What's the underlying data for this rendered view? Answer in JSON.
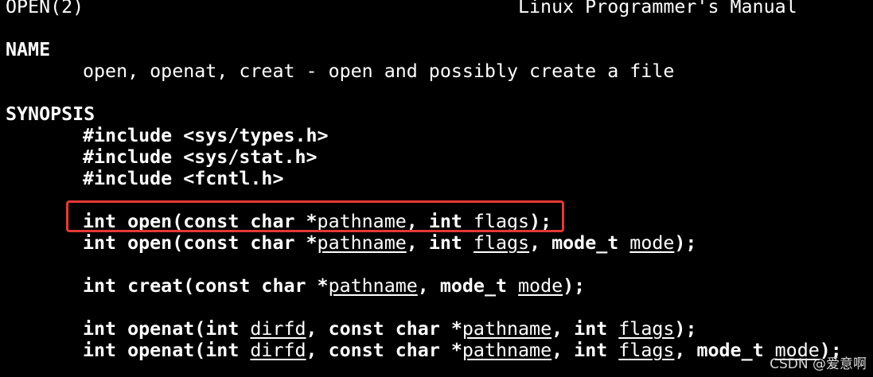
{
  "header": {
    "left": "OPEN(2)",
    "right": "Linux Programmer's Manual"
  },
  "sections": {
    "name": {
      "title": "NAME",
      "text": "open, openat, creat - open and possibly create a file"
    },
    "synopsis": {
      "title": "SYNOPSIS",
      "includes": [
        "#include <sys/types.h>",
        "#include <sys/stat.h>",
        "#include <fcntl.h>"
      ],
      "signatures": [
        {
          "head": "int open(const char *",
          "args": [
            {
              "sep": "",
              "name": "pathname"
            },
            {
              "sep": ", int ",
              "name": "flags"
            }
          ],
          "tail": ");"
        },
        {
          "head": "int open(const char *",
          "args": [
            {
              "sep": "",
              "name": "pathname"
            },
            {
              "sep": ", int ",
              "name": "flags"
            },
            {
              "sep": ", mode_t ",
              "name": "mode"
            }
          ],
          "tail": ");"
        },
        {
          "head": "int creat(const char *",
          "args": [
            {
              "sep": "",
              "name": "pathname"
            },
            {
              "sep": ", mode_t ",
              "name": "mode"
            }
          ],
          "tail": ");"
        },
        {
          "head": "int openat(int ",
          "args": [
            {
              "sep": "",
              "name": "dirfd"
            },
            {
              "sep": ", const char *",
              "name": "pathname"
            },
            {
              "sep": ", int ",
              "name": "flags"
            }
          ],
          "tail": ");"
        },
        {
          "head": "int openat(int ",
          "args": [
            {
              "sep": "",
              "name": "dirfd"
            },
            {
              "sep": ", const char *",
              "name": "pathname"
            },
            {
              "sep": ", int ",
              "name": "flags"
            },
            {
              "sep": ", mode_t ",
              "name": "mode"
            }
          ],
          "tail": ");"
        }
      ]
    }
  },
  "highlight": {
    "color": "#e53935"
  },
  "watermark": "CSDN @爱意啊",
  "colors": {
    "background": "#000000",
    "text": "#ffffff"
  }
}
